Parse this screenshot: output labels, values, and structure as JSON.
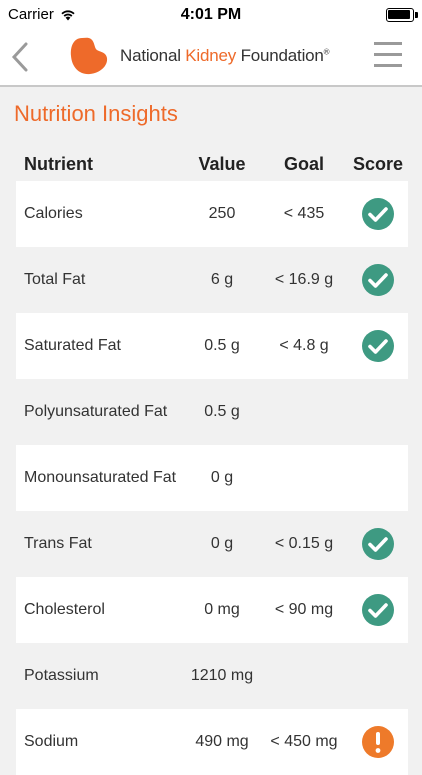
{
  "status_bar": {
    "carrier": "Carrier",
    "time": "4:01 PM"
  },
  "header": {
    "logo_text_1": "National ",
    "logo_text_accent": "Kidney",
    "logo_text_2": " Foundation",
    "logo_mark": "®"
  },
  "page_title": "Nutrition Insights",
  "table": {
    "headers": {
      "nutrient": "Nutrient",
      "value": "Value",
      "goal": "Goal",
      "score": "Score"
    },
    "rows": [
      {
        "nutrient": "Calories",
        "value": "250",
        "goal": "< 435",
        "score": "check"
      },
      {
        "nutrient": "Total Fat",
        "value": "6 g",
        "goal": "< 16.9 g",
        "score": "check"
      },
      {
        "nutrient": "Saturated Fat",
        "value": "0.5 g",
        "goal": "< 4.8 g",
        "score": "check"
      },
      {
        "nutrient": "Polyunsaturated Fat",
        "value": "0.5 g",
        "goal": "",
        "score": ""
      },
      {
        "nutrient": "Monounsaturated Fat",
        "value": "0 g",
        "goal": "",
        "score": ""
      },
      {
        "nutrient": "Trans Fat",
        "value": "0 g",
        "goal": "< 0.15 g",
        "score": "check"
      },
      {
        "nutrient": "Cholesterol",
        "value": "0 mg",
        "goal": "< 90 mg",
        "score": "check"
      },
      {
        "nutrient": "Potassium",
        "value": "1210 mg",
        "goal": "",
        "score": ""
      },
      {
        "nutrient": "Sodium",
        "value": "490 mg",
        "goal": "< 450 mg",
        "score": "warning"
      }
    ]
  },
  "colors": {
    "accent": "#ee6a2a",
    "check": "#3e9a82",
    "warning": "#ee7a2a"
  },
  "icons": {
    "back": "chevron-left-icon",
    "menu": "hamburger-menu-icon",
    "good": "check-circle-icon",
    "alert": "exclamation-circle-icon"
  }
}
